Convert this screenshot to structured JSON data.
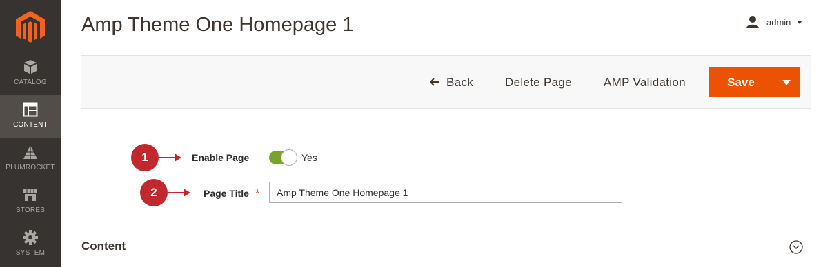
{
  "sidebar": {
    "items": [
      {
        "label": "CATALOG",
        "icon": "cube-icon"
      },
      {
        "label": "CONTENT",
        "icon": "layout-icon",
        "active": true
      },
      {
        "label": "PLUMROCKET",
        "icon": "pyramid-icon"
      },
      {
        "label": "STORES",
        "icon": "store-icon"
      },
      {
        "label": "SYSTEM",
        "icon": "gear-icon"
      }
    ]
  },
  "header": {
    "title": "Amp Theme One Homepage 1",
    "user": "admin"
  },
  "actions": {
    "back": "Back",
    "delete": "Delete Page",
    "amp_validation": "AMP Validation",
    "save": "Save"
  },
  "form": {
    "step1": "1",
    "step2": "2",
    "enable_label": "Enable Page",
    "enable_value": "Yes",
    "title_label": "Page Title",
    "required_mark": "*",
    "title_value": "Amp Theme One Homepage 1"
  },
  "sections": {
    "content_title": "Content"
  },
  "colors": {
    "sidebar_bg": "#373330",
    "accent": "#eb5202",
    "toggle_on": "#79a22e",
    "badge": "#c1272d"
  }
}
